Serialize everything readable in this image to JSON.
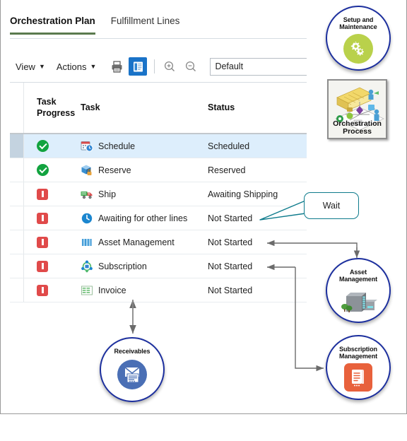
{
  "tabs": [
    {
      "label": "Orchestration Plan",
      "active": true
    },
    {
      "label": "Fulfillment Lines",
      "active": false
    }
  ],
  "toolbar": {
    "view_label": "View",
    "actions_label": "Actions",
    "caret": "▼",
    "print_icon": "print-icon",
    "detail_icon": "detail-view-icon",
    "zoom_in_icon": "zoom-in-icon",
    "zoom_out_icon": "zoom-out-icon",
    "input_value": "Default"
  },
  "table": {
    "headers": {
      "progress_line1": "Task",
      "progress_line2": "Progress",
      "task": "Task",
      "status": "Status"
    },
    "rows": [
      {
        "progress": "complete",
        "icon": "calendar-clock-icon",
        "task": "Schedule",
        "status": "Scheduled",
        "selected": true
      },
      {
        "progress": "complete",
        "icon": "box-lock-icon",
        "task": "Reserve",
        "status": "Reserved",
        "selected": false
      },
      {
        "progress": "stopped",
        "icon": "truck-icon",
        "task": "Ship",
        "status": "Awaiting Shipping",
        "selected": false
      },
      {
        "progress": "stopped",
        "icon": "clock-icon",
        "task": "Awaiting for other lines",
        "status": "Not Started",
        "selected": false
      },
      {
        "progress": "stopped",
        "icon": "barcode-icon",
        "task": "Asset Management",
        "status": "Not Started",
        "selected": false
      },
      {
        "progress": "stopped",
        "icon": "network-nodes-icon",
        "task": "Subscription",
        "status": "Not Started",
        "selected": false
      },
      {
        "progress": "stopped",
        "icon": "grid-table-icon",
        "task": "Invoice",
        "status": "Not Started",
        "selected": false
      }
    ]
  },
  "callout": {
    "wait_label": "Wait"
  },
  "nodes": {
    "setup": {
      "line1": "Setup and",
      "line2": "Maintenance",
      "icon": "gears-icon"
    },
    "orchestration": {
      "line1": "Orchestration",
      "line2": "Process",
      "icon": "process-diagram-icon"
    },
    "asset": {
      "line1": "Asset",
      "line2": "Management",
      "icon": "building-icon"
    },
    "subscription": {
      "line1": "Subscription",
      "line2": "Management",
      "icon": "document-scroll-icon"
    },
    "receivables": {
      "line1": "Receivables",
      "line2": "",
      "icon": "envelope-invoice-icon"
    }
  },
  "colors": {
    "tab_accent": "#5a7a4e",
    "toolbar_active": "#1a73c8",
    "row_selected": "#ddeefc",
    "status_ok": "#12a33f",
    "status_stopped": "#e04a4a",
    "callout_border": "#0e7b8c",
    "node_border": "#1c2f9e",
    "connector": "#6b6b6b",
    "subscription_orange": "#e8613c",
    "setup_green": "#b9d14b",
    "receivables_blue": "#4a6fb5"
  }
}
